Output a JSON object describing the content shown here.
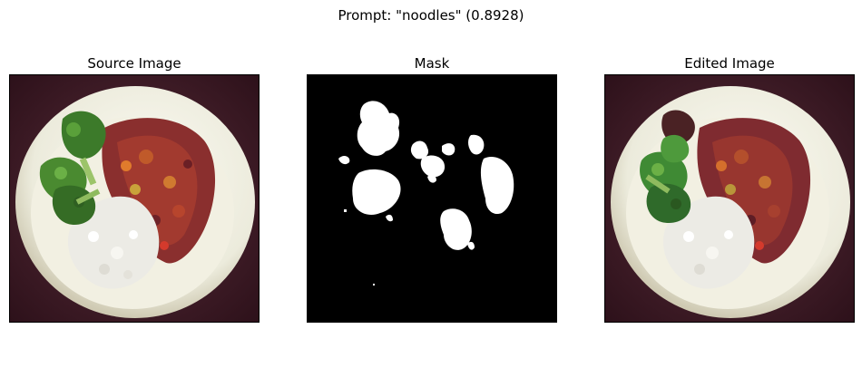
{
  "figure": {
    "suptitle": "Prompt: \"noodles\" (0.8928)"
  },
  "panels": [
    {
      "title": "Source Image"
    },
    {
      "title": "Mask"
    },
    {
      "title": "Edited Image"
    }
  ],
  "colors": {
    "background": "#ffffff",
    "table": "#3a1a24",
    "bowl": "#f3f1e6",
    "rice": "#e9e7e1",
    "stew": "#8a2f2e",
    "broccoli": "#3c7a2a",
    "mask_bg": "#000000",
    "mask_fg": "#ffffff"
  }
}
